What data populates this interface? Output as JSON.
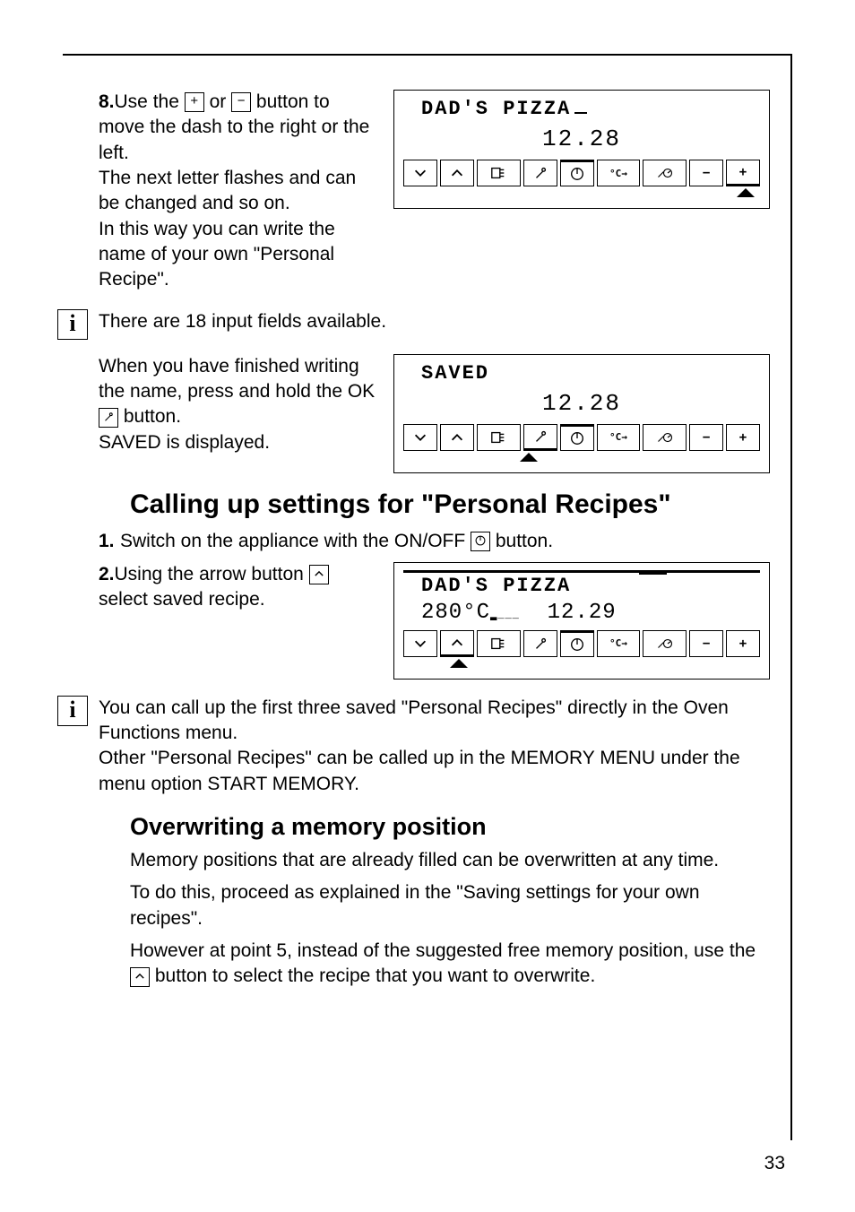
{
  "step8": {
    "num": "8.",
    "text_a": "Use the ",
    "text_b": " or ",
    "text_c": " button to move the dash to the right or the left.",
    "text_d": "The next letter flashes and can be changed and so on.",
    "text_e": "In this way you can write the name of your own \"Personal Recipe\"."
  },
  "info1": "There are 18 input fields available.",
  "save_para_a": "When you have finished writing the name, press and hold the OK ",
  "save_para_b": " button.",
  "save_para_c": "SAVED is displayed.",
  "h_calling": "Calling up settings for \"Personal Recipes\"",
  "step1": {
    "num": "1.",
    "text_a": "Switch on the appliance with the ON/OFF ",
    "text_b": " button."
  },
  "step2": {
    "num": "2.",
    "text_a": "Using the arrow button ",
    "text_b": " select saved recipe."
  },
  "info2_a": "You can call up the first three saved \"Personal Recipes\" directly in the Oven Functions menu.",
  "info2_b": "Other \"Personal Recipes\" can be called up in the MEMORY MENU under the menu option START MEMORY.",
  "h_over": "Overwriting a memory position",
  "over_p1": "Memory positions that are already filled can be overwritten at any time.",
  "over_p2": "To do this, proceed as explained in the \"Saving settings for your own recipes\".",
  "over_p3_a": "However at point 5, instead of the suggested free memory position, use the ",
  "over_p3_b": " button to select the recipe that you want to overwrite.",
  "page_num": "33",
  "disp1": {
    "title": "DAD'S PIZZA",
    "time": "12.28"
  },
  "disp2": {
    "title": "SAVED",
    "time": "12.28"
  },
  "disp3": {
    "title": "DAD'S PIZZA",
    "temp": "280°C",
    "time": "12.29"
  },
  "icons": {
    "plus": "+",
    "minus": "−",
    "ok": "✓",
    "onoff": "◯",
    "up_arrow": "⌃",
    "info": "i"
  }
}
